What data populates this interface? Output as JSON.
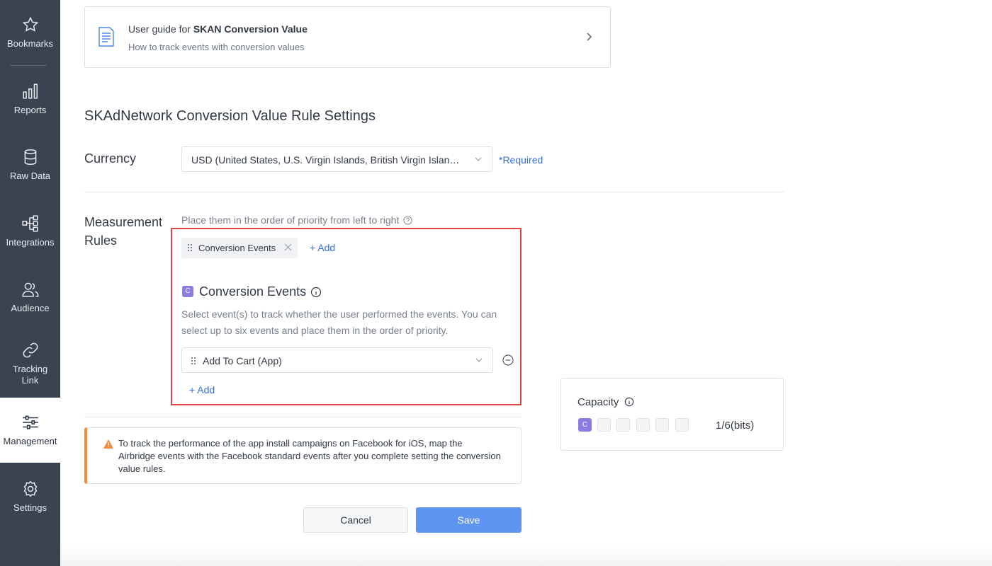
{
  "sidebar": {
    "items": [
      {
        "label": "Bookmarks",
        "icon": "star-icon"
      },
      {
        "label": "Reports",
        "icon": "bar-chart-icon"
      },
      {
        "label": "Raw Data",
        "icon": "database-icon"
      },
      {
        "label": "Integrations",
        "icon": "integrations-icon"
      },
      {
        "label": "Audience",
        "icon": "audience-icon"
      },
      {
        "label": "Tracking Link",
        "label_line1": "Tracking",
        "label_line2": "Link",
        "icon": "link-icon"
      },
      {
        "label": "Management",
        "icon": "sliders-icon",
        "active": true
      },
      {
        "label": "Settings",
        "icon": "gear-icon"
      }
    ]
  },
  "guide": {
    "title_prefix": "User guide for ",
    "title_bold": "SKAN Conversion Value",
    "subtitle": "How to track events with conversion values"
  },
  "page": {
    "title": "SKAdNetwork Conversion Value Rule Settings"
  },
  "currency": {
    "label": "Currency",
    "value": "USD (United States, U.S. Virgin Islands, British Virgin Islands...",
    "required": "*Required"
  },
  "measurement": {
    "label": "Measurement Rules",
    "hint": "Place them in the order of  priority from left to right",
    "chip_label": "Conversion Events",
    "add_label": "+ Add",
    "section_badge": "C",
    "section_title": "Conversion Events",
    "section_desc": "Select event(s) to track whether the user performed the events. You can select up to six events and place them in the order of priority.",
    "event_value": "Add To Cart (App)",
    "event_add_label": "+ Add"
  },
  "warning": {
    "text": "To track the performance of the app install campaigns on Facebook for iOS, map the Airbridge events with the Facebook standard events after you complete setting the conversion value rules."
  },
  "capacity": {
    "title": "Capacity",
    "filled_badge": "C",
    "used_bits": 1,
    "total_bits": 6,
    "count_text": "1/6(bits)"
  },
  "actions": {
    "cancel_label": "Cancel",
    "save_label": "Save"
  },
  "colors": {
    "sidebar_bg": "#3b4350",
    "accent_blue": "#2f6fde",
    "save_button": "#5d95f0",
    "badge_purple": "#8c7be0",
    "highlight_red": "#e0454a",
    "warning_orange": "#f08a3c"
  }
}
